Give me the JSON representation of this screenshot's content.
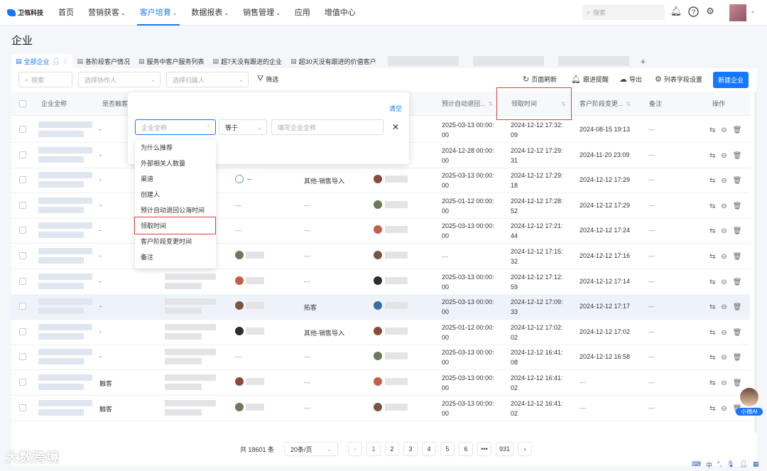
{
  "brand": {
    "name": "卫瓴科技"
  },
  "nav": [
    {
      "label": "首页",
      "caret": false,
      "active": false
    },
    {
      "label": "营销获客",
      "caret": true,
      "active": false
    },
    {
      "label": "客户培育",
      "caret": true,
      "active": true
    },
    {
      "label": "数据报表",
      "caret": true,
      "active": false
    },
    {
      "label": "销售管理",
      "caret": true,
      "active": false
    },
    {
      "label": "应用",
      "caret": false,
      "active": false
    },
    {
      "label": "增值中心",
      "caret": false,
      "active": false
    }
  ],
  "search": {
    "placeholder": "搜索"
  },
  "page": {
    "title": "企业"
  },
  "tabs": [
    "全部企业",
    "各阶段客户情况",
    "服务中客户服务列表",
    "超7天没有跟进的企业",
    "超30天没有跟进的价值客户"
  ],
  "filters": {
    "search_placeholder": "搜索",
    "collaborator_placeholder": "选择协作人",
    "owner_placeholder": "选择归属人",
    "filter_label": "筛选"
  },
  "toolbar": {
    "refresh": "页面刷新",
    "follow_remind": "跟进提醒",
    "export": "导出",
    "field_settings": "列表字段设置",
    "new": "新建企业"
  },
  "columns": {
    "name": "企业全称",
    "touched": "是否触客",
    "auto_return": "预计自动退回...",
    "claim_time": "领取时间",
    "stage_change": "客户阶段变更...",
    "remark": "备注",
    "ops": "操作"
  },
  "popup": {
    "clear": "清空",
    "field_placeholder": "企业全称",
    "operator": "等于",
    "value_placeholder": "填写企业全称"
  },
  "dropdown_options": [
    "为什么推荐",
    "外部相关人数量",
    "渠道",
    "创建人",
    "预计自动退回公海时间",
    "领取时间",
    "客户阶段变更时间",
    "备注"
  ],
  "rows": [
    {
      "touched": "-",
      "channel": "",
      "auto_return": [
        "2025-03-13 00:00:",
        "00"
      ],
      "claim": [
        "2024-12-12 17:32:",
        "09"
      ],
      "stage": "2024-08-15 19:13",
      "remark": "—"
    },
    {
      "touched": "-",
      "channel": "",
      "auto_return": [
        "2024-12-28 00:00:",
        "00"
      ],
      "claim": [
        "2024-12-12 17:29:",
        "31"
      ],
      "stage": "2024-11-20 23:09",
      "remark": "—"
    },
    {
      "touched": "-",
      "creator": "--",
      "channel": "其他-销售导入",
      "auto_return": [
        "2025-03-13 00:00:",
        "00"
      ],
      "claim": [
        "2024-12-12 17:29:",
        "18"
      ],
      "stage": "2024-12-12 17:29",
      "remark": "—"
    },
    {
      "touched": "-",
      "creator": "—",
      "channel": "—",
      "auto_return": [
        "2025-01-12 00:00:",
        "00"
      ],
      "claim": [
        "2024-12-12 17:28:",
        "52"
      ],
      "stage": "2024-12-12 17:29",
      "remark": "—"
    },
    {
      "touched": "-",
      "creator": "—",
      "channel": "—",
      "auto_return": [
        "2025-03-13 00:00:",
        "00"
      ],
      "claim": [
        "2024-12-12 17:21:",
        "44"
      ],
      "stage": "2024-12-12 17:24",
      "remark": "—"
    },
    {
      "touched": "-",
      "creator": "",
      "channel": "—",
      "auto_return": [
        "—",
        ""
      ],
      "claim": [
        "2024-12-12 17:15:",
        "32"
      ],
      "stage": "2024-12-12 17:16",
      "remark": "—"
    },
    {
      "touched": "-",
      "creator": "",
      "channel": "—",
      "auto_return": [
        "2025-03-13 00:00:",
        "00"
      ],
      "claim": [
        "2024-12-12 17:12:",
        "59"
      ],
      "stage": "2024-12-12 17:14",
      "remark": "—"
    },
    {
      "touched": "-",
      "creator": "",
      "channel": "拓客",
      "auto_return": [
        "2025-03-13 00:00:",
        "00"
      ],
      "claim": [
        "2024-12-12 17:09:",
        "33"
      ],
      "stage": "2024-12-12 17:17",
      "remark": "—"
    },
    {
      "touched": "-",
      "creator": "",
      "channel": "其他-销售导入",
      "auto_return": [
        "2025-01-12 00:00:",
        "00"
      ],
      "claim": [
        "2024-12-12 17:02:",
        "02"
      ],
      "stage": "2024-12-12 17:02",
      "remark": "—"
    },
    {
      "touched": "-",
      "creator": "—",
      "channel": "—",
      "auto_return": [
        "2025-03-13 00:00:",
        "00"
      ],
      "claim": [
        "2024-12-12 16:41:",
        "08"
      ],
      "stage": "2024-12-12 16:58",
      "remark": "—"
    },
    {
      "touched": "触客",
      "creator": "",
      "channel": "—",
      "auto_return": [
        "2025-03-13 00:00:",
        "00"
      ],
      "claim": [
        "2024-12-12 16:41:",
        "02"
      ],
      "stage": "—",
      "remark": "—"
    },
    {
      "touched": "触客",
      "creator": "",
      "channel": "—",
      "auto_return": [
        "2025-03-13 00:00:",
        "00"
      ],
      "claim": [
        "2024-12-12 16:41:",
        "02"
      ],
      "stage": "—",
      "remark": "—"
    }
  ],
  "pager": {
    "total": "共 18601 条",
    "page_size": "20条/页",
    "pages": [
      "1",
      "2",
      "3",
      "4",
      "5",
      "6",
      "•••",
      "931"
    ],
    "current": "1"
  },
  "watermark": "大数跨境",
  "assistant": {
    "label": "小微AI"
  },
  "bottom_tools": {
    "lang": "中"
  },
  "colors": {
    "primary": "#1677ff",
    "highlight": "#e03b3b"
  }
}
